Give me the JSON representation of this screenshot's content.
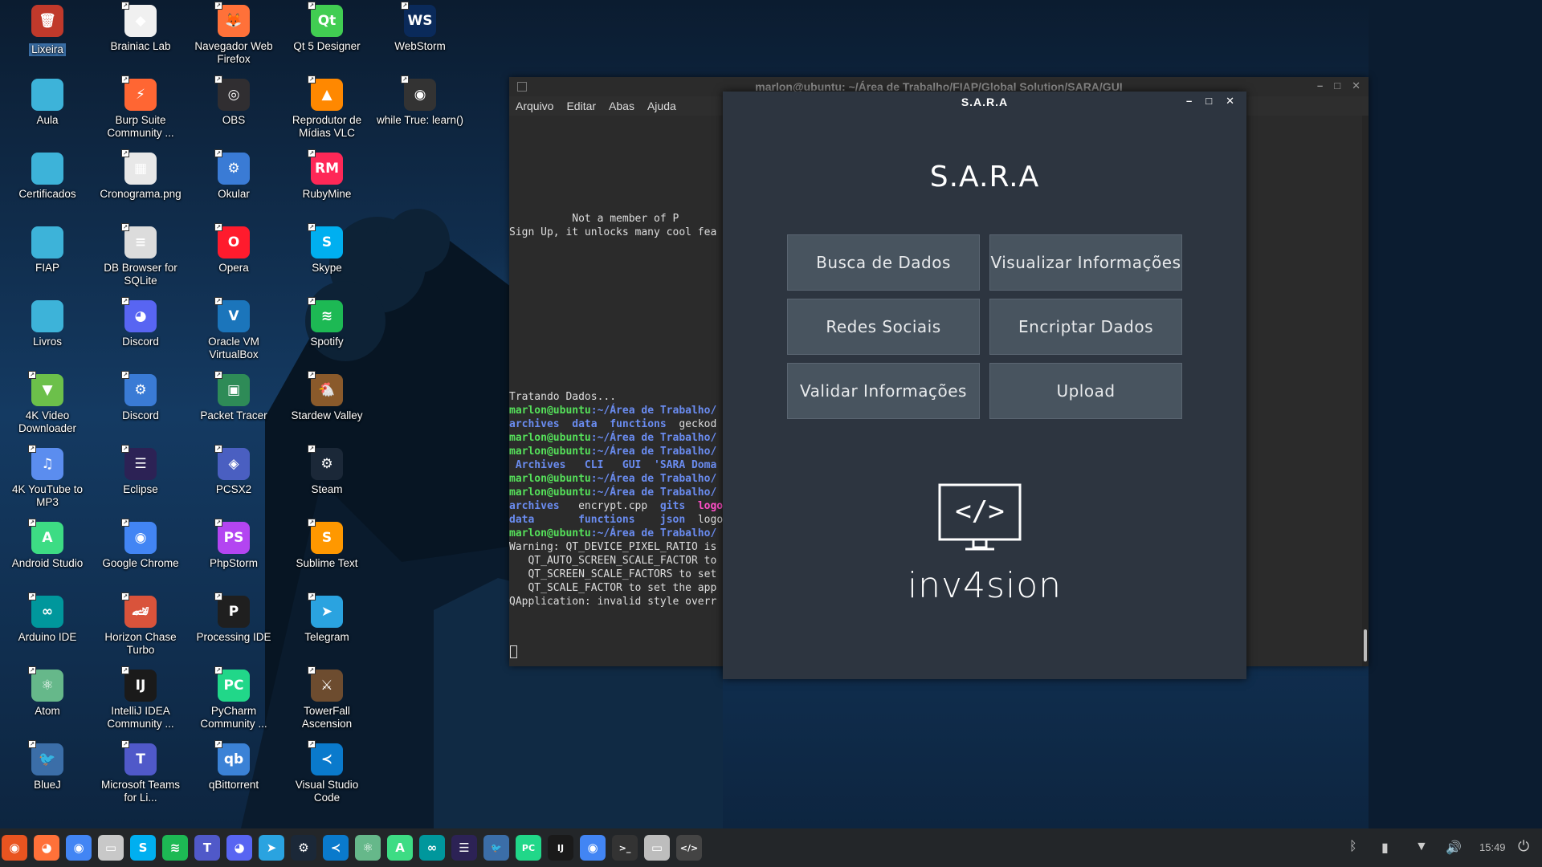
{
  "desktop": {
    "icons": [
      {
        "label": "Lixeira",
        "icon": "trash-icon",
        "color": "#c0392b",
        "glyph": "🗑",
        "selected": true
      },
      {
        "label": "Aula",
        "icon": "folder-icon",
        "color": "#3db3d9",
        "glyph": ""
      },
      {
        "label": "Certificados",
        "icon": "folder-icon",
        "color": "#3db3d9",
        "glyph": ""
      },
      {
        "label": "FIAP",
        "icon": "folder-icon",
        "color": "#3db3d9",
        "glyph": ""
      },
      {
        "label": "Livros",
        "icon": "folder-icon",
        "color": "#3db3d9",
        "glyph": ""
      },
      {
        "label": "4K Video Downloader",
        "icon": "4k-video-icon",
        "color": "#6cc04a",
        "glyph": "▼"
      },
      {
        "label": "4K YouTube to MP3",
        "icon": "4k-youtube-icon",
        "color": "#5b8def",
        "glyph": "♫"
      },
      {
        "label": "Android Studio",
        "icon": "android-studio-icon",
        "color": "#3ddc84",
        "glyph": "A"
      },
      {
        "label": "Arduino IDE",
        "icon": "arduino-icon",
        "color": "#00979c",
        "glyph": "∞"
      },
      {
        "label": "Atom",
        "icon": "atom-icon",
        "color": "#66b88a",
        "glyph": "⚛"
      },
      {
        "label": "BlueJ",
        "icon": "bluej-icon",
        "color": "#3b6ea8",
        "glyph": "🐦"
      },
      {
        "label": "Brainiac Lab",
        "icon": "brainiac-icon",
        "color": "#f0f0f0",
        "glyph": "◆"
      },
      {
        "label": "Burp Suite Community ...",
        "icon": "burp-icon",
        "color": "#ff6633",
        "glyph": "⚡"
      },
      {
        "label": "Cronograma.png",
        "icon": "image-file-icon",
        "color": "#e8e8e8",
        "glyph": "▦"
      },
      {
        "label": "DB Browser for SQLite",
        "icon": "sqlite-icon",
        "color": "#dcdcdc",
        "glyph": "≡"
      },
      {
        "label": "Discord",
        "icon": "discord-icon",
        "color": "#5865f2",
        "glyph": "◕"
      },
      {
        "label": "Discord",
        "icon": "gear-icon",
        "color": "#3a7bd5",
        "glyph": "⚙"
      },
      {
        "label": "Eclipse",
        "icon": "eclipse-icon",
        "color": "#2c2255",
        "glyph": "☰"
      },
      {
        "label": "Google Chrome",
        "icon": "chrome-icon",
        "color": "#4285f4",
        "glyph": "◉"
      },
      {
        "label": "Horizon Chase Turbo",
        "icon": "horizon-chase-icon",
        "color": "#d9533b",
        "glyph": "🏎"
      },
      {
        "label": "IntelliJ IDEA Community ...",
        "icon": "intellij-icon",
        "color": "#1a1a1a",
        "glyph": "IJ"
      },
      {
        "label": "Microsoft Teams for Li...",
        "icon": "teams-icon",
        "color": "#5059c9",
        "glyph": "T"
      },
      {
        "label": "Navegador Web Firefox",
        "icon": "firefox-icon",
        "color": "#ff7139",
        "glyph": "🦊"
      },
      {
        "label": "OBS",
        "icon": "obs-icon",
        "color": "#302e31",
        "glyph": "◎"
      },
      {
        "label": "Okular",
        "icon": "okular-icon",
        "color": "#3a7bd5",
        "glyph": "⚙"
      },
      {
        "label": "Opera",
        "icon": "opera-icon",
        "color": "#ff1b2d",
        "glyph": "O"
      },
      {
        "label": "Oracle VM VirtualBox",
        "icon": "virtualbox-icon",
        "color": "#1b75bb",
        "glyph": "V"
      },
      {
        "label": "Packet Tracer",
        "icon": "packet-tracer-icon",
        "color": "#2e8b57",
        "glyph": "▣"
      },
      {
        "label": "PCSX2",
        "icon": "pcsx2-icon",
        "color": "#4a5fc1",
        "glyph": "◈"
      },
      {
        "label": "PhpStorm",
        "icon": "phpstorm-icon",
        "color": "#b345f1",
        "glyph": "PS"
      },
      {
        "label": "Processing IDE",
        "icon": "processing-icon",
        "color": "#1f1f1f",
        "glyph": "P"
      },
      {
        "label": "PyCharm Community ...",
        "icon": "pycharm-icon",
        "color": "#21d789",
        "glyph": "PC"
      },
      {
        "label": "qBittorrent",
        "icon": "qbittorrent-icon",
        "color": "#3b82d6",
        "glyph": "qb"
      },
      {
        "label": "Qt 5 Designer",
        "icon": "qt-designer-icon",
        "color": "#41cd52",
        "glyph": "Qt"
      },
      {
        "label": "Reprodutor de Mídias VLC",
        "icon": "vlc-icon",
        "color": "#ff8800",
        "glyph": "▲"
      },
      {
        "label": "RubyMine",
        "icon": "rubymine-icon",
        "color": "#fe2857",
        "glyph": "RM"
      },
      {
        "label": "Skype",
        "icon": "skype-icon",
        "color": "#00aff0",
        "glyph": "S"
      },
      {
        "label": "Spotify",
        "icon": "spotify-icon",
        "color": "#1db954",
        "glyph": "≋"
      },
      {
        "label": "Stardew Valley",
        "icon": "stardew-icon",
        "color": "#8a5a2b",
        "glyph": "🐔"
      },
      {
        "label": "Steam",
        "icon": "steam-icon",
        "color": "#1b2838",
        "glyph": "⚙"
      },
      {
        "label": "Sublime Text",
        "icon": "sublime-icon",
        "color": "#ff9800",
        "glyph": "S"
      },
      {
        "label": "Telegram",
        "icon": "telegram-icon",
        "color": "#2aa3e0",
        "glyph": "➤"
      },
      {
        "label": "TowerFall Ascension",
        "icon": "towerfall-icon",
        "color": "#6d4c2f",
        "glyph": "⚔"
      },
      {
        "label": "Visual Studio Code",
        "icon": "vscode-icon",
        "color": "#0a7acc",
        "glyph": "≺"
      },
      {
        "label": "WebStorm",
        "icon": "webstorm-icon",
        "color": "#0a2a5a",
        "glyph": "WS"
      },
      {
        "label": "while True: learn()",
        "icon": "while-true-learn-icon",
        "color": "#333333",
        "glyph": "◉"
      }
    ]
  },
  "terminal": {
    "title": "marlon@ubuntu: ~/Área de Trabalho/FIAP/Global Solution/SARA/GUI",
    "menu": [
      "Arquivo",
      "Editar",
      "Abas",
      "Ajuda"
    ],
    "lines": [
      {
        "segments": [
          {
            "text": "          Not a member of P",
            "cls": ""
          }
        ]
      },
      {
        "segments": [
          {
            "text": "Sign Up, it unlocks many cool fea",
            "cls": ""
          }
        ]
      },
      {
        "segments": [
          {
            "text": "Tratando Dados...",
            "cls": ""
          }
        ]
      },
      {
        "segments": [
          {
            "text": "marlon@ubuntu",
            "cls": "c-green"
          },
          {
            "text": ":~/Área de Trabalho/",
            "cls": "c-blue"
          }
        ]
      },
      {
        "segments": [
          {
            "text": "archives",
            "cls": "c-blue"
          },
          {
            "text": "  ",
            "cls": ""
          },
          {
            "text": "data",
            "cls": "c-blue"
          },
          {
            "text": "  ",
            "cls": ""
          },
          {
            "text": "functions",
            "cls": "c-blue"
          },
          {
            "text": "  geckod",
            "cls": ""
          }
        ]
      },
      {
        "segments": [
          {
            "text": "marlon@ubuntu",
            "cls": "c-green"
          },
          {
            "text": ":~/Área de Trabalho/",
            "cls": "c-blue"
          }
        ]
      },
      {
        "segments": [
          {
            "text": "marlon@ubuntu",
            "cls": "c-green"
          },
          {
            "text": ":~/Área de Trabalho/",
            "cls": "c-blue"
          }
        ]
      },
      {
        "segments": [
          {
            "text": " Archives   CLI   GUI  'SARA Doma",
            "cls": "c-blue"
          }
        ]
      },
      {
        "segments": [
          {
            "text": "marlon@ubuntu",
            "cls": "c-green"
          },
          {
            "text": ":~/Área de Trabalho/",
            "cls": "c-blue"
          }
        ]
      },
      {
        "segments": [
          {
            "text": "marlon@ubuntu",
            "cls": "c-green"
          },
          {
            "text": ":~/Área de Trabalho/",
            "cls": "c-blue"
          }
        ]
      },
      {
        "segments": [
          {
            "text": "archives",
            "cls": "c-blue"
          },
          {
            "text": "   encrypt.cpp  ",
            "cls": ""
          },
          {
            "text": "gits",
            "cls": "c-blue"
          },
          {
            "text": "  ",
            "cls": ""
          },
          {
            "text": "logo",
            "cls": "c-pink"
          }
        ]
      },
      {
        "segments": [
          {
            "text": "data",
            "cls": "c-blue"
          },
          {
            "text": "       ",
            "cls": ""
          },
          {
            "text": "functions",
            "cls": "c-blue"
          },
          {
            "text": "    ",
            "cls": ""
          },
          {
            "text": "json",
            "cls": "c-blue"
          },
          {
            "text": "  logo",
            "cls": ""
          }
        ]
      },
      {
        "segments": [
          {
            "text": "marlon@ubuntu",
            "cls": "c-green"
          },
          {
            "text": ":~/Área de Trabalho/",
            "cls": "c-blue"
          }
        ]
      },
      {
        "segments": [
          {
            "text": "Warning: QT_DEVICE_PIXEL_RATIO is",
            "cls": ""
          }
        ]
      },
      {
        "segments": [
          {
            "text": "   QT_AUTO_SCREEN_SCALE_FACTOR to",
            "cls": ""
          }
        ]
      },
      {
        "segments": [
          {
            "text": "   QT_SCREEN_SCALE_FACTORS to set",
            "cls": ""
          }
        ]
      },
      {
        "segments": [
          {
            "text": "   QT_SCALE_FACTOR to set the app",
            "cls": ""
          }
        ]
      },
      {
        "segments": [
          {
            "text": "QApplication: invalid style overr",
            "cls": ""
          }
        ]
      }
    ]
  },
  "sara": {
    "window_title": "S.A.R.A",
    "app_title": "S.A.R.A",
    "buttons": [
      "Busca de Dados",
      "Visualizar Informações",
      "Redes Sociais",
      "Encriptar Dados",
      "Validar Informações",
      "Upload"
    ],
    "logo_glyph": "</>",
    "logo_text": "inv4sion"
  },
  "taskbar": {
    "apps": [
      {
        "name": "ubuntu-menu-icon",
        "color": "#e95420",
        "glyph": "◉"
      },
      {
        "name": "firefox-icon",
        "color": "#ff7139",
        "glyph": "◕"
      },
      {
        "name": "chrome-icon",
        "color": "#4285f4",
        "glyph": "◉"
      },
      {
        "name": "file-manager-icon",
        "color": "#c8c8c8",
        "glyph": "▭"
      },
      {
        "name": "skype-icon",
        "color": "#00aff0",
        "glyph": "S"
      },
      {
        "name": "spotify-icon",
        "color": "#1db954",
        "glyph": "≋"
      },
      {
        "name": "teams-icon",
        "color": "#5059c9",
        "glyph": "T"
      },
      {
        "name": "discord-icon",
        "color": "#5865f2",
        "glyph": "◕"
      },
      {
        "name": "telegram-icon",
        "color": "#2aa3e0",
        "glyph": "➤"
      },
      {
        "name": "steam-icon",
        "color": "#1b2838",
        "glyph": "⚙"
      },
      {
        "name": "vscode-icon",
        "color": "#0a7acc",
        "glyph": "≺"
      },
      {
        "name": "atom-icon",
        "color": "#66b88a",
        "glyph": "⚛"
      },
      {
        "name": "android-studio-icon",
        "color": "#3ddc84",
        "glyph": "A"
      },
      {
        "name": "arduino-icon",
        "color": "#00979c",
        "glyph": "∞"
      },
      {
        "name": "eclipse-icon",
        "color": "#2c2255",
        "glyph": "☰"
      },
      {
        "name": "bluej-icon",
        "color": "#3b6ea8",
        "glyph": "🐦"
      },
      {
        "name": "pycharm-icon",
        "color": "#21d789",
        "glyph": "PC"
      },
      {
        "name": "intellij-icon",
        "color": "#1a1a1a",
        "glyph": "IJ"
      },
      {
        "name": "chrome-running-icon",
        "color": "#4285f4",
        "glyph": "◉"
      },
      {
        "name": "terminal-icon",
        "color": "#333333",
        "glyph": ">_"
      },
      {
        "name": "files-running-icon",
        "color": "#bdbdbd",
        "glyph": "▭"
      },
      {
        "name": "sara-running-icon",
        "color": "#444444",
        "glyph": "</>"
      }
    ],
    "tray": [
      {
        "name": "bluetooth-icon",
        "glyph": "ᛒ"
      },
      {
        "name": "battery-icon",
        "glyph": "▮"
      },
      {
        "name": "wifi-icon",
        "glyph": "▼"
      },
      {
        "name": "volume-icon",
        "glyph": "🔊"
      }
    ],
    "clock": "15:49",
    "power_glyph": "⏻"
  }
}
